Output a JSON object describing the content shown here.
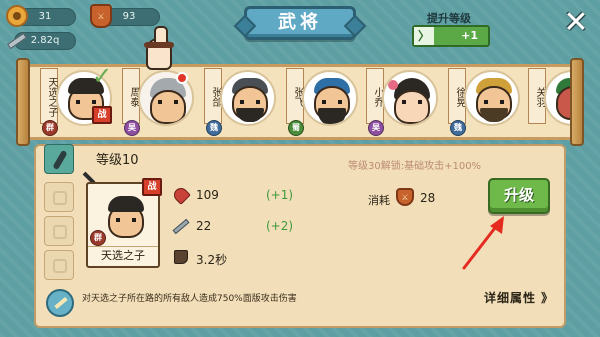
{
  "resources": {
    "coins": "31",
    "badges": "93",
    "power": "2.82q",
    "badge_glyph": "⚔"
  },
  "title": "武将",
  "upgrade_level": {
    "label": "提升等级",
    "arrow": "〉",
    "value": "+1"
  },
  "close_glyph": "✕",
  "heroes": [
    {
      "name": "天选之子",
      "faction": "群",
      "zhan": "战"
    },
    {
      "name": "周泰",
      "faction": "吴"
    },
    {
      "name": "张郃",
      "faction": "魏"
    },
    {
      "name": "张飞",
      "faction": "蜀"
    },
    {
      "name": "小乔",
      "faction": "吴"
    },
    {
      "name": "徐晃",
      "faction": "魏"
    },
    {
      "name": "关羽",
      "faction": ""
    }
  ],
  "check_glyph": "✓",
  "detail": {
    "level": "等级10",
    "unlock_info": "等级30解锁:基础攻击+100%",
    "card": {
      "name": "天选之子",
      "faction": "群",
      "zhan": "战"
    },
    "stats": {
      "hp": "109",
      "hp_gain": "(+1)",
      "attack": "22",
      "attack_gain": "(+2)",
      "speed": "3.2秒"
    },
    "cost_label": "消耗",
    "cost_value": "28",
    "upgrade_button": "升级",
    "skill_text": "对天选之子所在路的所有敌人造成750%面版攻击伤害",
    "detail_link": "详细属性 》"
  },
  "colors": {
    "background": "#5e9fa3",
    "banner": "#5fa9c4",
    "upgrade_green": "#6fb94b",
    "panel": "#f2dfba",
    "arrow_red": "#e52a20"
  },
  "icons": [
    "coin-icon",
    "badge-icon",
    "sword-icon",
    "close-icon",
    "heart-icon",
    "attack-sword-icon",
    "boot-icon",
    "skill-sword-icon",
    "pointer-hand-icon"
  ]
}
